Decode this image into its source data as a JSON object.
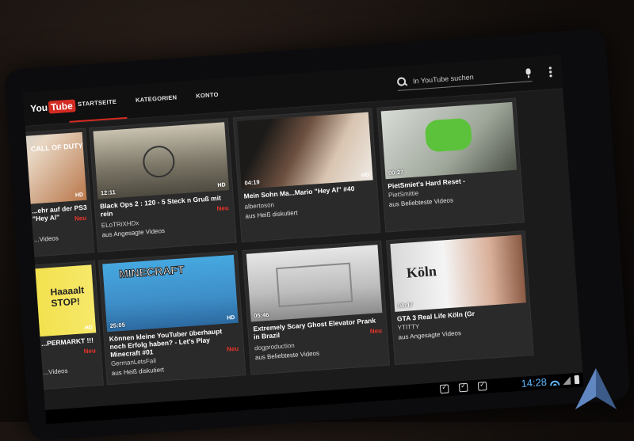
{
  "app": {
    "logo_you": "You",
    "logo_tube": "Tube",
    "tabs": [
      {
        "label": "STARTSEITE",
        "active": true
      },
      {
        "label": "KATEGORIEN",
        "active": false
      },
      {
        "label": "KONTO",
        "active": false
      }
    ],
    "search": {
      "placeholder": "In YouTube suchen"
    }
  },
  "videos": [
    {
      "title": "...ehr auf der PS3 \"Hey Al\"",
      "channel": "",
      "source": "...Videos",
      "duration": "",
      "hd": "HD",
      "badge": "Neu",
      "thumb_text": "CALL OF DUTY"
    },
    {
      "title": "Black Ops 2 : 120 - 5 Steck n Gruß mit rein",
      "channel": "ELoTRiXHDx",
      "source": "aus Angesagte Videos",
      "duration": "12:11",
      "hd": "HD",
      "badge": "Neu",
      "thumb_text": ""
    },
    {
      "title": "Mein Sohn Ma...Mario \"Hey Al\" #40",
      "channel": "albertoson",
      "source": "aus Heiß diskutiert",
      "duration": "04:19",
      "hd": "HD",
      "badge": "",
      "thumb_text": ""
    },
    {
      "title": "PietSmiet's Hard Reset -",
      "channel": "PietSmittie",
      "source": "aus Beliebteste Videos",
      "duration": "00:27",
      "hd": "",
      "badge": "",
      "thumb_text": ""
    },
    {
      "title": "...PERMARKT !!!",
      "channel": "",
      "source": "...Videos",
      "duration": "",
      "hd": "HD",
      "badge": "Neu",
      "thumb_text": "Haaaalt STOP!"
    },
    {
      "title": "Können kleine YouTuber überhaupt noch Erfolg haben? - Let's Play Minecraft #01",
      "channel": "GermanLetsFail",
      "source": "aus Heiß diskutiert",
      "duration": "25:05",
      "hd": "HD",
      "badge": "Neu",
      "thumb_text": "MINECRAFT"
    },
    {
      "title": "Extremely Scary Ghost Elevator Prank in Brazil",
      "channel": "dogproduction",
      "source": "aus Beliebteste Videos",
      "duration": "05:46",
      "hd": "",
      "badge": "Neu",
      "thumb_text": ""
    },
    {
      "title": "GTA 3 Real Life Köln (Gr",
      "channel": "YTITTY",
      "source": "aus Angesagte Videos",
      "duration": "04:47",
      "hd": "",
      "badge": "",
      "thumb_text": "Köln"
    }
  ],
  "status": {
    "time": "14:28"
  },
  "colors": {
    "accent": "#d32b22",
    "badge": "#e8342a",
    "status_blue": "#5fb8ff"
  }
}
